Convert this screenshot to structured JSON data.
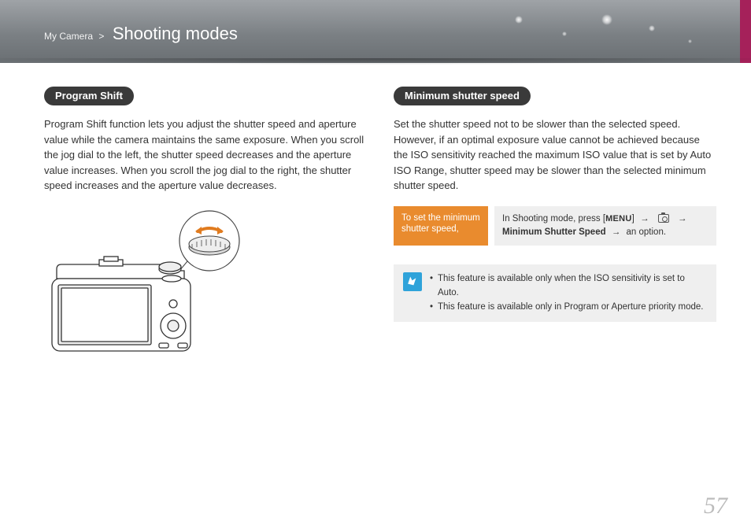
{
  "header": {
    "breadcrumb_root": "My Camera",
    "breadcrumb_sep": ">",
    "title": "Shooting modes"
  },
  "left": {
    "heading": "Program Shift",
    "body": "Program Shift function lets you adjust the shutter speed and aperture value while the camera maintains the same exposure. When you scroll the jog dial to the left, the shutter speed decreases and the aperture value increases. When you scroll the jog dial to the right, the shutter speed increases and the aperture value decreases."
  },
  "right": {
    "heading": "Minimum shutter speed",
    "body": "Set the shutter speed not to be slower than the selected speed. However, if an optimal exposure value cannot be achieved because the ISO sensitivity reached the maximum ISO value that is set by Auto ISO Range, shutter speed may be slower than the selected minimum shutter speed.",
    "instruction": {
      "tag": "To set the minimum shutter speed,",
      "pre_text": "In Shooting mode, press [",
      "menu_label": "MENU",
      "post_bracket": "]",
      "arrow": "→",
      "option_label": "Minimum Shutter Speed",
      "suffix": "an option."
    },
    "notes": [
      "This feature is available only when the ISO sensitivity is set to Auto.",
      "This feature is available only in Program or Aperture priority mode."
    ]
  },
  "page_number": "57"
}
